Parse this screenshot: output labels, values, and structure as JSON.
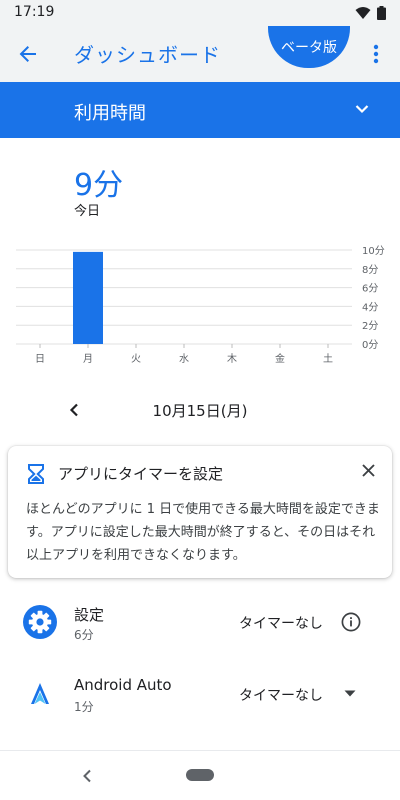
{
  "status_bar": {
    "time": "17:19"
  },
  "app_bar": {
    "title": "ダッシュボード",
    "beta_label": "ベータ版"
  },
  "selector": {
    "label": "利用時間"
  },
  "summary": {
    "value": "9分",
    "label": "今日"
  },
  "chart_data": {
    "type": "bar",
    "categories": [
      "日",
      "月",
      "火",
      "水",
      "木",
      "金",
      "土"
    ],
    "values": [
      0,
      9.8,
      0,
      0,
      0,
      0,
      0
    ],
    "y_ticks": [
      "0分",
      "2分",
      "4分",
      "6分",
      "8分",
      "10分"
    ],
    "y_tick_values": [
      0,
      2,
      4,
      6,
      8,
      10
    ],
    "ylim": [
      0,
      10
    ],
    "title": "",
    "xlabel": "",
    "ylabel": "",
    "grid": true,
    "color": "#1a73e8"
  },
  "date_nav": {
    "label": "10月15日(月)"
  },
  "timer_card": {
    "title": "アプリにタイマーを設定",
    "body": "ほとんどのアプリに 1 日で使用できる最大時間を設定できます。アプリに設定した最大時間が終了すると、その日はそれ以上アプリを利用できなくなります。"
  },
  "apps": [
    {
      "name": "設定",
      "usage": "6分",
      "timer": "タイマーなし",
      "icon": "settings-gear-icon",
      "action_icon": "info-icon"
    },
    {
      "name": "Android Auto",
      "usage": "1分",
      "timer": "タイマーなし",
      "icon": "android-auto-icon",
      "action_icon": "dropdown-arrow-icon"
    }
  ],
  "colors": {
    "accent": "#1a73e8",
    "surface": "#f1f3f4"
  }
}
